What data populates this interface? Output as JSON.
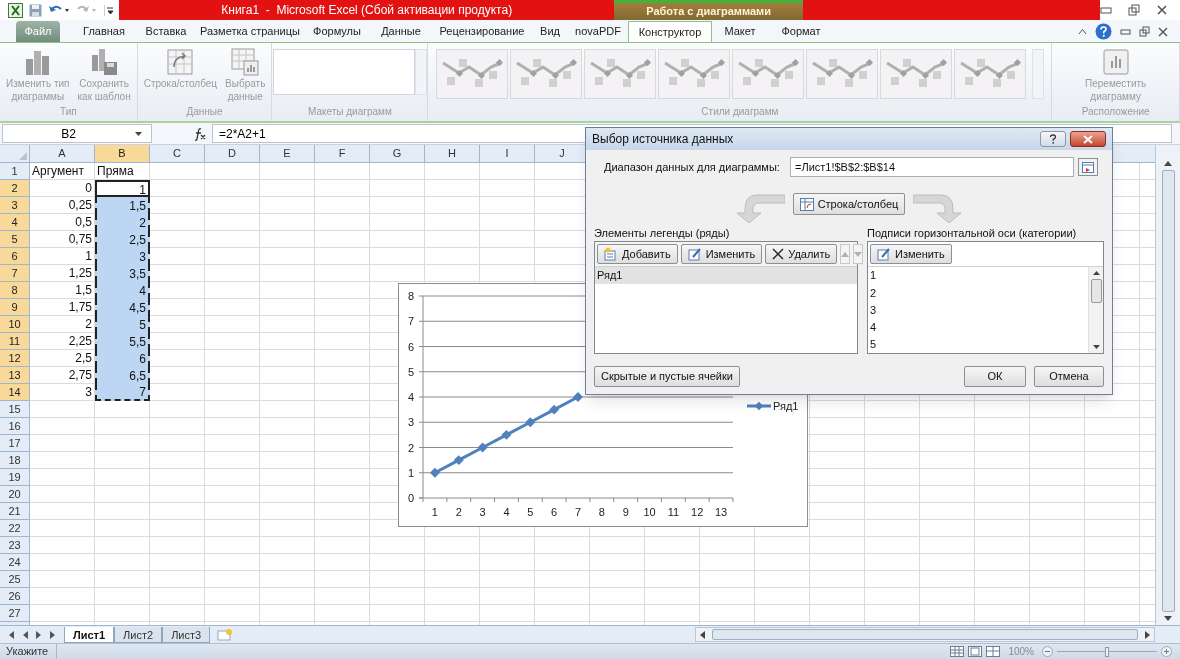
{
  "title_bar": {
    "title": "Книга1  -  Microsoft Excel (Сбой активации продукта)",
    "context_label": "Работа с диаграммами"
  },
  "tabs": [
    {
      "label": "Файл",
      "kind": "file",
      "selected": false
    },
    {
      "label": "Главная",
      "kind": "normal",
      "selected": false
    },
    {
      "label": "Вставка",
      "kind": "normal",
      "selected": false
    },
    {
      "label": "Разметка страницы",
      "kind": "normal",
      "selected": false
    },
    {
      "label": "Формулы",
      "kind": "normal",
      "selected": false
    },
    {
      "label": "Данные",
      "kind": "normal",
      "selected": false
    },
    {
      "label": "Рецензирование",
      "kind": "normal",
      "selected": false
    },
    {
      "label": "Вид",
      "kind": "normal",
      "selected": false
    },
    {
      "label": "novaPDF",
      "kind": "normal",
      "selected": false
    },
    {
      "label": "Конструктор",
      "kind": "context",
      "selected": true
    },
    {
      "label": "Макет",
      "kind": "context",
      "selected": false
    },
    {
      "label": "Формат",
      "kind": "context",
      "selected": false
    }
  ],
  "ribbon": {
    "disabled": true,
    "groups": [
      {
        "label": "Тип",
        "kind": "buttons",
        "buttons": [
          {
            "label": "Изменить тип\nдиаграммы",
            "kind": "chart-type"
          },
          {
            "label": "Сохранить\nкак шаблон",
            "kind": "save-template"
          }
        ]
      },
      {
        "label": "Данные",
        "kind": "buttons",
        "buttons": [
          {
            "label": "Строка/столбец",
            "kind": "switch"
          },
          {
            "label": "Выбрать\nданные",
            "kind": "select-data"
          }
        ]
      },
      {
        "label": "Макеты диаграмм",
        "kind": "layouts"
      },
      {
        "label": "Стили диаграмм",
        "kind": "styles"
      },
      {
        "label": "Расположение",
        "kind": "buttons",
        "buttons": [
          {
            "label": "Переместить\nдиаграмму",
            "kind": "move"
          }
        ]
      }
    ]
  },
  "formula_bar": {
    "name_box": "B2",
    "formula": "=2*A2+1"
  },
  "sheet": {
    "columns": [
      {
        "label": "A",
        "selected": false
      },
      {
        "label": "B",
        "selected": true
      },
      {
        "label": "C",
        "selected": false
      },
      {
        "label": "D",
        "selected": false
      },
      {
        "label": "E",
        "selected": false
      },
      {
        "label": "F",
        "selected": false
      },
      {
        "label": "G",
        "selected": false
      },
      {
        "label": "H",
        "selected": false
      },
      {
        "label": "I",
        "selected": false
      },
      {
        "label": "J",
        "selected": false
      }
    ],
    "rows": [
      {
        "header": "1",
        "selected": false,
        "cells": [
          {
            "text": "Аргумент",
            "kind": "text"
          },
          {
            "text": "Пряма",
            "kind": "text"
          }
        ]
      },
      {
        "header": "2",
        "selected": true,
        "cells": [
          {
            "text": "0",
            "kind": "number"
          },
          {
            "text": "1",
            "kind": "number",
            "active": true,
            "marquee": true
          }
        ]
      },
      {
        "header": "3",
        "selected": true,
        "cells": [
          {
            "text": "0,25",
            "kind": "number"
          },
          {
            "text": "1,5",
            "kind": "number",
            "selected": true,
            "marquee": true
          }
        ]
      },
      {
        "header": "4",
        "selected": true,
        "cells": [
          {
            "text": "0,5",
            "kind": "number"
          },
          {
            "text": "2",
            "kind": "number",
            "selected": true,
            "marquee": true
          }
        ]
      },
      {
        "header": "5",
        "selected": true,
        "cells": [
          {
            "text": "0,75",
            "kind": "number"
          },
          {
            "text": "2,5",
            "kind": "number",
            "selected": true,
            "marquee": true
          }
        ]
      },
      {
        "header": "6",
        "selected": true,
        "cells": [
          {
            "text": "1",
            "kind": "number"
          },
          {
            "text": "3",
            "kind": "number",
            "selected": true,
            "marquee": true
          }
        ]
      },
      {
        "header": "7",
        "selected": true,
        "cells": [
          {
            "text": "1,25",
            "kind": "number"
          },
          {
            "text": "3,5",
            "kind": "number",
            "selected": true,
            "marquee": true
          }
        ]
      },
      {
        "header": "8",
        "selected": true,
        "cells": [
          {
            "text": "1,5",
            "kind": "number"
          },
          {
            "text": "4",
            "kind": "number",
            "selected": true,
            "marquee": true
          }
        ]
      },
      {
        "header": "9",
        "selected": true,
        "cells": [
          {
            "text": "1,75",
            "kind": "number"
          },
          {
            "text": "4,5",
            "kind": "number",
            "selected": true,
            "marquee": true
          }
        ]
      },
      {
        "header": "10",
        "selected": true,
        "cells": [
          {
            "text": "2",
            "kind": "number"
          },
          {
            "text": "5",
            "kind": "number",
            "selected": true,
            "marquee": true
          }
        ]
      },
      {
        "header": "11",
        "selected": true,
        "cells": [
          {
            "text": "2,25",
            "kind": "number"
          },
          {
            "text": "5,5",
            "kind": "number",
            "selected": true,
            "marquee": true
          }
        ]
      },
      {
        "header": "12",
        "selected": true,
        "cells": [
          {
            "text": "2,5",
            "kind": "number"
          },
          {
            "text": "6",
            "kind": "number",
            "selected": true,
            "marquee": true
          }
        ]
      },
      {
        "header": "13",
        "selected": true,
        "cells": [
          {
            "text": "2,75",
            "kind": "number"
          },
          {
            "text": "6,5",
            "kind": "number",
            "selected": true,
            "marquee": true
          }
        ]
      },
      {
        "header": "14",
        "selected": true,
        "cells": [
          {
            "text": "3",
            "kind": "number"
          },
          {
            "text": "7",
            "kind": "number",
            "selected": true,
            "marquee": true
          }
        ]
      },
      {
        "header": "15",
        "selected": false
      },
      {
        "header": "16",
        "selected": false
      },
      {
        "header": "17",
        "selected": false
      },
      {
        "header": "18",
        "selected": false
      },
      {
        "header": "19",
        "selected": false
      },
      {
        "header": "20",
        "selected": false
      },
      {
        "header": "21",
        "selected": false
      },
      {
        "header": "22",
        "selected": false
      },
      {
        "header": "23",
        "selected": false
      },
      {
        "header": "24",
        "selected": false
      },
      {
        "header": "25",
        "selected": false
      },
      {
        "header": "26",
        "selected": false
      },
      {
        "header": "27",
        "selected": false
      }
    ],
    "chart": {
      "chart_data": {
        "type": "line",
        "grid": true,
        "categories": [
          "1",
          "2",
          "3",
          "4",
          "5",
          "6",
          "7",
          "8",
          "9",
          "10",
          "11",
          "12",
          "13"
        ],
        "ylim": [
          0,
          8
        ],
        "yticks": [
          0,
          1,
          2,
          3,
          4,
          5,
          6,
          7,
          8
        ],
        "series": [
          {
            "name": "Ряд1",
            "color": "#4f81bd",
            "marker": "diamond",
            "values": [
              1,
              1.5,
              2,
              2.5,
              3,
              3.5,
              4,
              null,
              null,
              null,
              null,
              null,
              null
            ]
          }
        ]
      }
    }
  },
  "dialog": {
    "title": "Выбор источника данных",
    "range_label": "Диапазон данных для диаграммы:",
    "range_value": "=Лист1!$B$2:$B$14",
    "switch_button": "Строка/столбец",
    "legend": {
      "title": "Элементы легенды (ряды)",
      "buttons": [
        {
          "label": "Добавить",
          "kind": "add"
        },
        {
          "label": "Изменить",
          "kind": "edit"
        },
        {
          "label": "Удалить",
          "kind": "delete"
        }
      ],
      "move_disabled": true,
      "items": [
        {
          "label": "Ряд1",
          "selected": true
        }
      ]
    },
    "axis": {
      "title": "Подписи горизонтальной оси (категории)",
      "button": "Изменить",
      "items": [
        "1",
        "2",
        "3",
        "4",
        "5"
      ]
    },
    "hidden_cells_button": "Скрытые и пустые ячейки",
    "ok_button": "ОК",
    "cancel_button": "Отмена"
  },
  "sheet_tabs": [
    {
      "label": "Лист1",
      "selected": true
    },
    {
      "label": "Лист2",
      "selected": false
    },
    {
      "label": "Лист3",
      "selected": false
    }
  ],
  "status_bar": {
    "mode": "Укажите",
    "zoom": "100%",
    "zoom_slider": {
      "level": 0.5
    }
  }
}
